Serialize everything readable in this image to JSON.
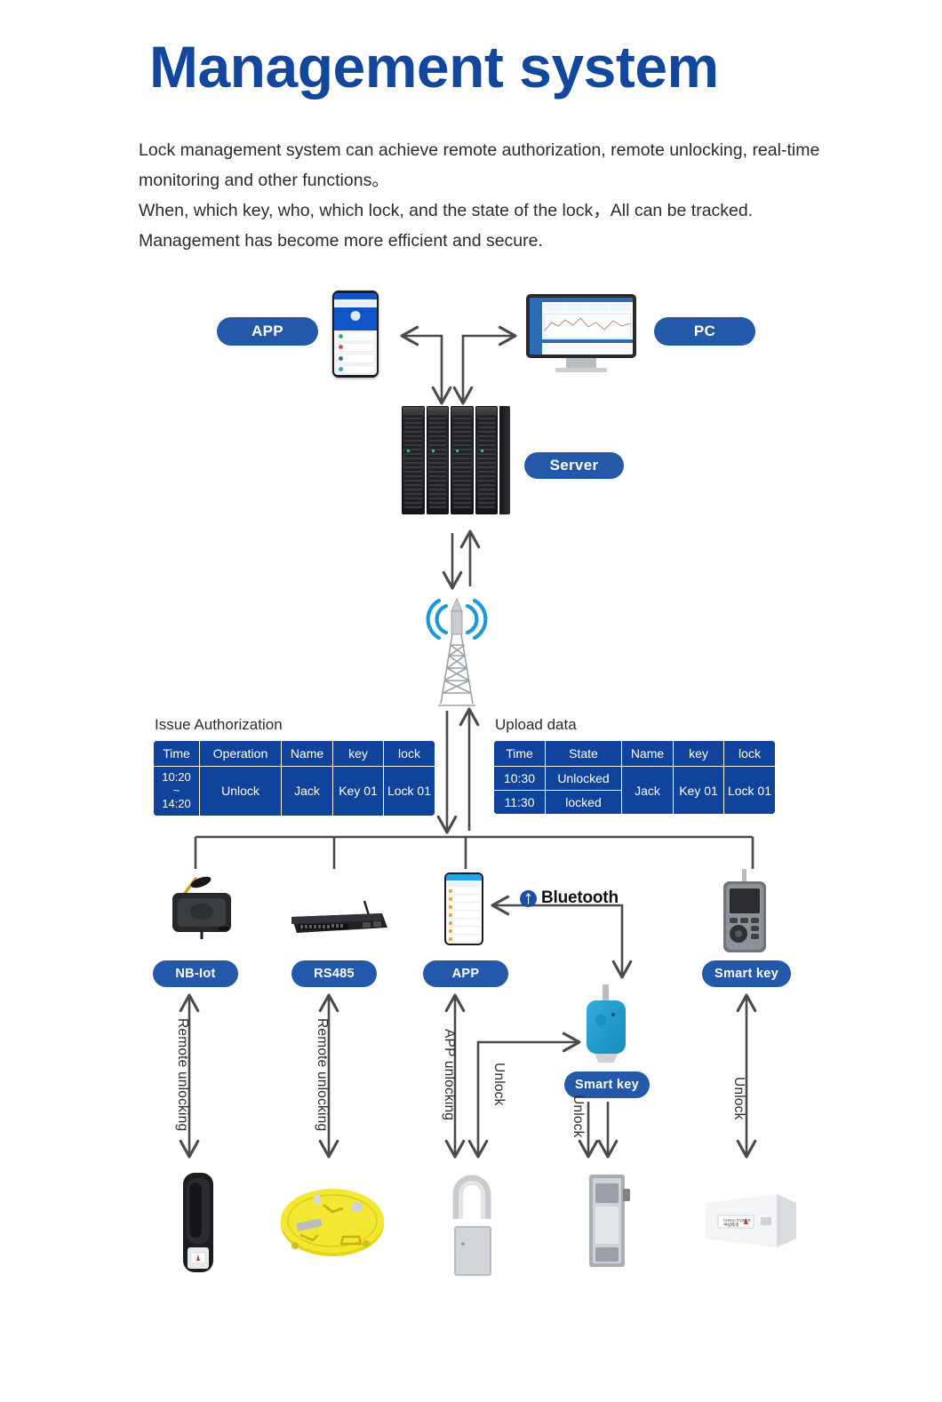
{
  "header": {
    "title": "Management system",
    "paragraphs": [
      "Lock management system can achieve remote authorization, remote unlocking, real-time monitoring and other functions。",
      "When, which key, who, which lock, and the state of the lock，All can be tracked.",
      "Management has become more efficient and secure."
    ]
  },
  "top_nodes": {
    "app_label": "APP",
    "pc_label": "PC",
    "server_label": "Server"
  },
  "tables": {
    "issue": {
      "title": "Issue Authorization",
      "headers": [
        "Time",
        "Operation",
        "Name",
        "key",
        "lock"
      ],
      "rows": [
        [
          "10:20\n~\n14:20",
          "Unlock",
          "Jack",
          "Key 01",
          "Lock 01"
        ]
      ],
      "time_lines": [
        "10:20",
        "~",
        "14:20"
      ]
    },
    "upload": {
      "title": "Upload data",
      "headers": [
        "Time",
        "State",
        "Name",
        "key",
        "lock"
      ],
      "rows": [
        [
          "10:30",
          "Unlocked",
          "Jack",
          "Key 01",
          "Lock 01"
        ],
        [
          "11:30",
          "locked",
          "",
          "",
          ""
        ]
      ]
    }
  },
  "channels": [
    {
      "label": "NB-Iot",
      "action": "Remote unlocking"
    },
    {
      "label": "RS485",
      "action": "Remote unlocking"
    },
    {
      "label": "APP",
      "action": "APP unlocking"
    },
    {
      "label": "Smart key",
      "action": "Unlock"
    }
  ],
  "middle": {
    "bluetooth_label": "Bluetooth",
    "bluetooth_glyph": "bluetooth-icon",
    "smart_key_label": "Smart key",
    "unlock_label_app_branch": "Unlock",
    "unlock_label_key_branch": "Unlock"
  },
  "colors": {
    "title_blue": "#13479e",
    "pill_blue": "#2359a8",
    "table_blue": "#10439b",
    "wire_gray": "#4b4b4b",
    "signal_blue": "#1c9ad6"
  },
  "icons": {
    "phone": "smartphone-icon",
    "monitor": "desktop-monitor-icon",
    "server": "server-rack-icon",
    "tower": "cell-tower-icon",
    "nb_iot": "nbiot-gateway-icon",
    "rs485": "rs485-switch-icon",
    "smart_key_device": "handheld-smart-key-icon",
    "key_fob": "key-fob-icon",
    "lock_handle": "handle-lock-icon",
    "lock_manhole": "manhole-cover-lock-icon",
    "lock_padlock": "padlock-icon",
    "lock_cabinet": "cabinet-lock-icon",
    "lock_meterbox": "meter-box-lock-icon"
  }
}
